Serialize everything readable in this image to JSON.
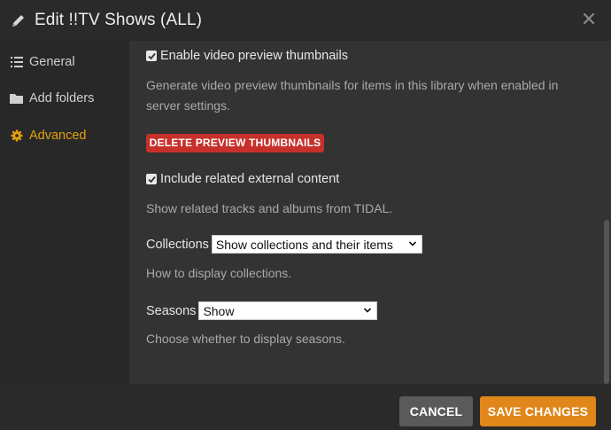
{
  "dialog": {
    "title": "Edit !!TV Shows (ALL)"
  },
  "sidebar": {
    "items": [
      {
        "label": "General",
        "icon": "list-icon",
        "active": false
      },
      {
        "label": "Add folders",
        "icon": "folder-icon",
        "active": false
      },
      {
        "label": "Advanced",
        "icon": "gear-icon",
        "active": true
      }
    ]
  },
  "settings": {
    "video_thumbnails": {
      "label": "Enable video preview thumbnails",
      "checked": true,
      "help": "Generate video preview thumbnails for items in this library when enabled in server settings.",
      "delete_button": "DELETE PREVIEW THUMBNAILS"
    },
    "related_content": {
      "label": "Include related external content",
      "checked": true,
      "help": "Show related tracks and albums from TIDAL."
    },
    "collections": {
      "label": "Collections",
      "value": "Show collections and their items",
      "help": "How to display collections."
    },
    "seasons": {
      "label": "Seasons",
      "value": "Show",
      "help": "Choose whether to display seasons."
    }
  },
  "footer": {
    "cancel_label": "CANCEL",
    "save_label": "SAVE CHANGES"
  },
  "colors": {
    "accent": "#e5a00d",
    "danger": "#c7302a",
    "save": "#e0861a",
    "cancel": "#5a5a5a"
  }
}
